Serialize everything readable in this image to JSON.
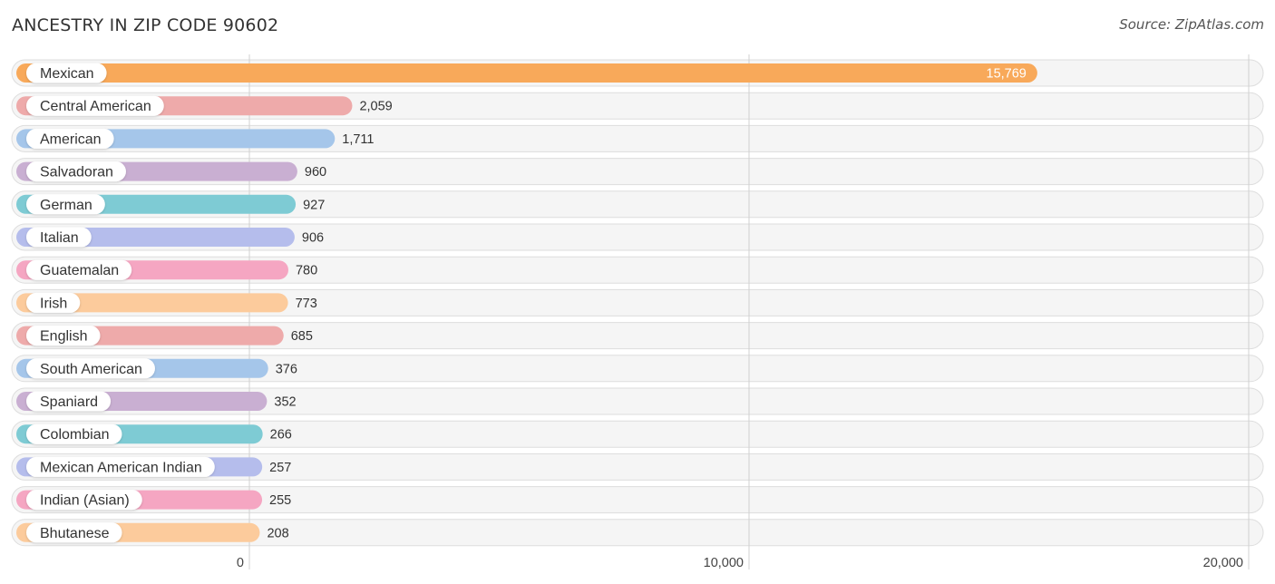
{
  "header": {
    "title": "ANCESTRY IN ZIP CODE 90602",
    "source": "Source: ZipAtlas.com"
  },
  "chart_data": {
    "type": "bar",
    "orientation": "horizontal",
    "title": "ANCESTRY IN ZIP CODE 90602",
    "xlabel": "",
    "ylabel": "",
    "xlim": [
      0,
      20000
    ],
    "grid": true,
    "x_ticks": [
      0,
      10000,
      20000
    ],
    "x_tick_labels": [
      "0",
      "10,000",
      "20,000"
    ],
    "categories": [
      "Mexican",
      "Central American",
      "American",
      "Salvadoran",
      "German",
      "Italian",
      "Guatemalan",
      "Irish",
      "English",
      "South American",
      "Spaniard",
      "Colombian",
      "Mexican American Indian",
      "Indian (Asian)",
      "Bhutanese"
    ],
    "values": [
      15769,
      2059,
      1711,
      960,
      927,
      906,
      780,
      773,
      685,
      376,
      352,
      266,
      257,
      255,
      208
    ],
    "value_labels": [
      "15,769",
      "2,059",
      "1,711",
      "960",
      "927",
      "906",
      "780",
      "773",
      "685",
      "376",
      "352",
      "266",
      "257",
      "255",
      "208"
    ],
    "colors": [
      "#f8a95a",
      "#eeaaaa",
      "#a5c6ea",
      "#c9afd2",
      "#7ecbd4",
      "#b5bdec",
      "#f5a6c2",
      "#fccb9c",
      "#eeaaaa",
      "#a5c6ea",
      "#c9afd2",
      "#7ecbd4",
      "#b5bdec",
      "#f5a6c2",
      "#fccb9c"
    ]
  }
}
